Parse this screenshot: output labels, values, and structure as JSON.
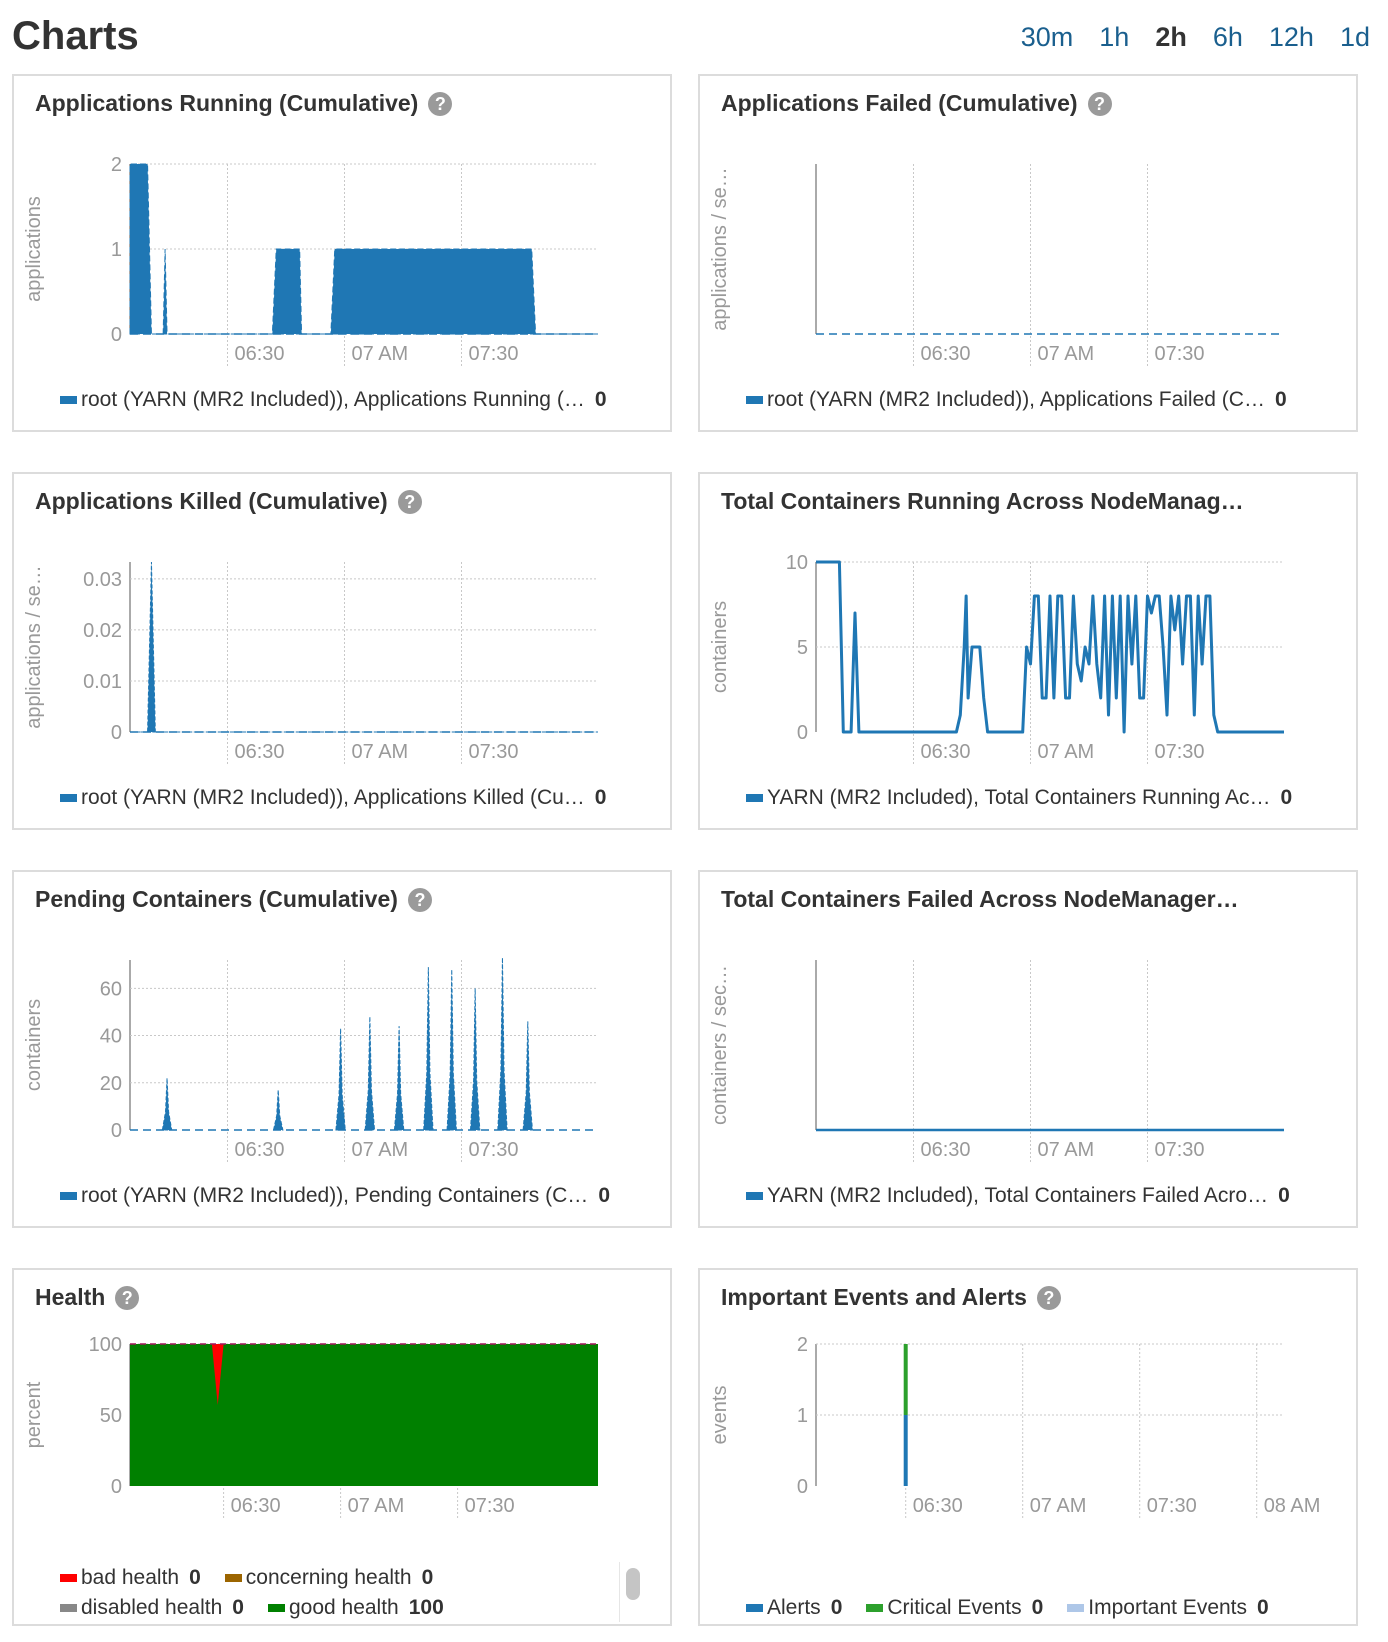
{
  "page": {
    "title": "Charts",
    "ranges": [
      {
        "label": "30m",
        "active": false
      },
      {
        "label": "1h",
        "active": false
      },
      {
        "label": "2h",
        "active": true
      },
      {
        "label": "6h",
        "active": false
      },
      {
        "label": "12h",
        "active": false
      },
      {
        "label": "1d",
        "active": false
      }
    ]
  },
  "colors": {
    "series_blue": "#1f77b4",
    "bad": "#ff0000",
    "concerning": "#9c6500",
    "disabled": "#888888",
    "good": "#008000",
    "critical": "#2ca02c",
    "important": "#aec7e8",
    "link": "#1a5f8e"
  },
  "chart_data": [
    {
      "id": "apps-running",
      "type": "area",
      "title": "Applications Running (Cumulative)",
      "ylabel": "applications",
      "ylim": [
        0,
        2
      ],
      "yticks": [
        "0",
        "1",
        "2"
      ],
      "xlim_minutes": [
        0,
        120
      ],
      "xticks": [
        {
          "t": 25,
          "label": "06:30"
        },
        {
          "t": 55,
          "label": "07 AM"
        },
        {
          "t": 85,
          "label": "07:30"
        }
      ],
      "x_minutes": [
        0,
        0.3,
        4.5,
        5.5,
        8.5,
        9,
        9.5,
        36,
        36.5,
        37.5,
        43.5,
        44,
        51.5,
        52.5,
        53,
        103,
        104,
        120
      ],
      "values": [
        2,
        2,
        2,
        0,
        0,
        1,
        0,
        0,
        0,
        1,
        1,
        0,
        0,
        1,
        1,
        1,
        0,
        0
      ],
      "legend": [
        {
          "label": "root (YARN (MR2 Included)), Applications Running (…",
          "value": "0",
          "color": "#1f77b4"
        }
      ]
    },
    {
      "id": "apps-failed",
      "type": "line",
      "title": "Applications Failed (Cumulative)",
      "ylabel": "applications / se…",
      "yticks": [],
      "xlim_minutes": [
        0,
        120
      ],
      "xticks": [
        {
          "t": 25,
          "label": "06:30"
        },
        {
          "t": 55,
          "label": "07 AM"
        },
        {
          "t": 85,
          "label": "07:30"
        }
      ],
      "x_minutes": [
        0,
        120
      ],
      "values": [
        0,
        0
      ],
      "legend": [
        {
          "label": "root (YARN (MR2 Included)), Applications Failed (C…",
          "value": "0",
          "color": "#1f77b4"
        }
      ]
    },
    {
      "id": "apps-killed",
      "type": "area",
      "title": "Applications Killed (Cumulative)",
      "ylabel": "applications / se…",
      "ylim": [
        0,
        0.0333
      ],
      "yticks": [
        "0",
        "0.01",
        "0.02",
        "0.03"
      ],
      "xlim_minutes": [
        0,
        120
      ],
      "xticks": [
        {
          "t": 25,
          "label": "06:30"
        },
        {
          "t": 55,
          "label": "07 AM"
        },
        {
          "t": 85,
          "label": "07:30"
        }
      ],
      "x_minutes": [
        0,
        4.5,
        5.5,
        6.5,
        120
      ],
      "values": [
        0,
        0,
        0.0333,
        0,
        0
      ],
      "legend": [
        {
          "label": "root (YARN (MR2 Included)), Applications Killed (Cu…",
          "value": "0",
          "color": "#1f77b4"
        }
      ]
    },
    {
      "id": "containers-running",
      "type": "line",
      "title": "Total Containers Running Across NodeManag…",
      "ylabel": "containers",
      "ylim": [
        0,
        10
      ],
      "yticks": [
        "0",
        "5",
        "10"
      ],
      "xlim_minutes": [
        0,
        120
      ],
      "xticks": [
        {
          "t": 25,
          "label": "06:30"
        },
        {
          "t": 55,
          "label": "07 AM"
        },
        {
          "t": 85,
          "label": "07:30"
        }
      ],
      "x_minutes": [
        0,
        6,
        7,
        9,
        10,
        11,
        12,
        36,
        37,
        38,
        38.5,
        39,
        40,
        42,
        43,
        44,
        53,
        54,
        55,
        56,
        57,
        58,
        59,
        60,
        61,
        62,
        63,
        64,
        65,
        66,
        67,
        68,
        69,
        70,
        71,
        72,
        73,
        74,
        75,
        76,
        77,
        78,
        79,
        80,
        81,
        82,
        83,
        84,
        85,
        86,
        87,
        88,
        89,
        90,
        91,
        92,
        93,
        94,
        95,
        96,
        97,
        98,
        99,
        100,
        101,
        102,
        103,
        104,
        105,
        120
      ],
      "values": [
        10,
        10,
        0,
        0,
        7,
        0,
        0,
        0,
        1,
        5,
        8,
        2,
        5,
        5,
        2,
        0,
        0,
        5,
        4,
        8,
        8,
        2,
        2,
        8,
        2,
        8,
        8,
        2,
        2,
        8,
        4,
        3,
        5,
        4,
        8,
        4,
        2,
        8,
        1,
        8,
        2,
        8,
        0,
        8,
        4,
        8,
        2,
        2,
        8,
        7,
        8,
        8,
        5,
        1,
        8,
        6,
        8,
        4,
        8,
        8,
        1,
        8,
        4,
        8,
        8,
        1,
        0,
        0,
        0,
        0
      ],
      "legend": [
        {
          "label": "YARN (MR2 Included), Total Containers Running Ac…",
          "value": "0",
          "color": "#1f77b4"
        }
      ]
    },
    {
      "id": "pending-containers",
      "type": "area",
      "title": "Pending Containers (Cumulative)",
      "ylabel": "containers",
      "ylim": [
        0,
        72
      ],
      "yticks": [
        "0",
        "20",
        "40",
        "60"
      ],
      "xlim_minutes": [
        0,
        120
      ],
      "xticks": [
        {
          "t": 25,
          "label": "06:30"
        },
        {
          "t": 55,
          "label": "07 AM"
        },
        {
          "t": 85,
          "label": "07:30"
        }
      ],
      "peaks_minutes": [
        9.5,
        38,
        54,
        61.5,
        69,
        76.5,
        82.5,
        88.5,
        95.5,
        102
      ],
      "peaks_values": [
        22,
        17,
        43,
        48,
        44,
        69,
        68,
        60,
        73,
        46
      ],
      "legend": [
        {
          "label": "root (YARN (MR2 Included)), Pending Containers (C…",
          "value": "0",
          "color": "#1f77b4"
        }
      ]
    },
    {
      "id": "containers-failed",
      "type": "line",
      "title": "Total Containers Failed Across NodeManager…",
      "ylabel": "containers / sec…",
      "yticks": [],
      "xlim_minutes": [
        0,
        120
      ],
      "xticks": [
        {
          "t": 25,
          "label": "06:30"
        },
        {
          "t": 55,
          "label": "07 AM"
        },
        {
          "t": 85,
          "label": "07:30"
        }
      ],
      "x_minutes": [
        0,
        120
      ],
      "values": [
        0,
        0
      ],
      "legend": [
        {
          "label": "YARN (MR2 Included), Total Containers Failed Acro…",
          "value": "0",
          "color": "#1f77b4"
        }
      ]
    },
    {
      "id": "health",
      "type": "area",
      "title": "Health",
      "ylabel": "percent",
      "ylim": [
        0,
        100
      ],
      "yticks": [
        "0",
        "50",
        "100"
      ],
      "xlim_minutes": [
        0,
        120
      ],
      "xticks": [
        {
          "t": 24,
          "label": "06:30"
        },
        {
          "t": 54,
          "label": "07 AM"
        },
        {
          "t": 84,
          "label": "07:30"
        }
      ],
      "series": [
        {
          "name": "good health",
          "x_minutes": [
            0,
            21,
            22.5,
            24,
            120
          ],
          "values": [
            100,
            100,
            57,
            100,
            100
          ]
        }
      ],
      "legend": [
        {
          "label": "bad health",
          "value": "0",
          "color": "#ff0000"
        },
        {
          "label": "concerning health",
          "value": "0",
          "color": "#9c6500"
        },
        {
          "label": "disabled health",
          "value": "0",
          "color": "#888888"
        },
        {
          "label": "good health",
          "value": "100",
          "color": "#008000"
        }
      ]
    },
    {
      "id": "events",
      "type": "bar",
      "title": "Important Events and Alerts",
      "ylabel": "events",
      "ylim": [
        0,
        2
      ],
      "yticks": [
        "0",
        "1",
        "2"
      ],
      "xlim_minutes": [
        0,
        120
      ],
      "xticks": [
        {
          "t": 23,
          "label": "06:30"
        },
        {
          "t": 53,
          "label": "07 AM"
        },
        {
          "t": 83,
          "label": "07:30"
        },
        {
          "t": 113,
          "label": "08 AM"
        }
      ],
      "series": [
        {
          "name": "Alerts",
          "x_minutes": [
            23
          ],
          "values": [
            1
          ]
        },
        {
          "name": "Critical Events",
          "x_minutes": [
            23
          ],
          "values": [
            1
          ]
        }
      ],
      "legend": [
        {
          "label": "Alerts",
          "value": "0",
          "color": "#1f77b4"
        },
        {
          "label": "Critical Events",
          "value": "0",
          "color": "#2ca02c"
        },
        {
          "label": "Important Events",
          "value": "0",
          "color": "#aec7e8"
        }
      ]
    }
  ]
}
